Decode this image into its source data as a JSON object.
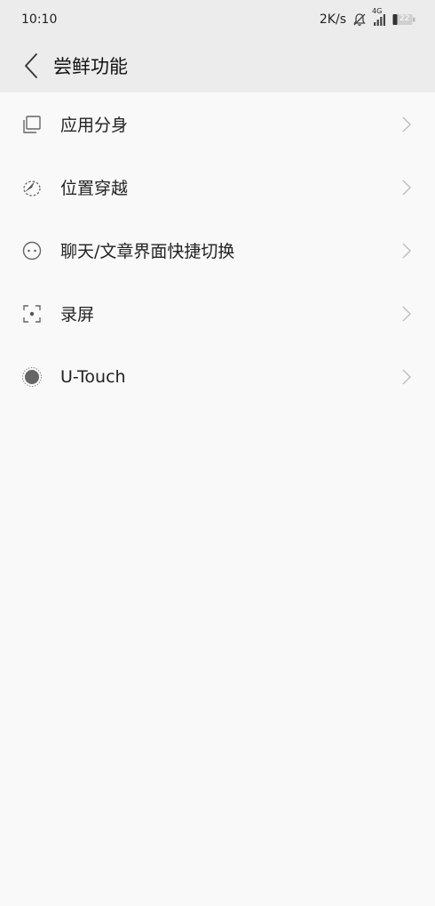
{
  "status_bar": {
    "time": "10:10",
    "network_speed": "2K/s",
    "network_type": "4G",
    "battery": "22",
    "icons": [
      "mute-bell-icon",
      "signal-icon",
      "battery-icon"
    ]
  },
  "header": {
    "back_icon": "back-chevron-icon",
    "title": "尝鲜功能"
  },
  "items": [
    {
      "label": "应用分身",
      "icon": "app-clone-icon"
    },
    {
      "label": "位置穿越",
      "icon": "location-travel-icon"
    },
    {
      "label": "聊天/文章界面快捷切换",
      "icon": "chat-switch-icon"
    },
    {
      "label": "录屏",
      "icon": "screen-record-icon"
    },
    {
      "label": "U-Touch",
      "icon": "u-touch-icon"
    }
  ],
  "colors": {
    "background": "#f9f9f9",
    "header_background": "#ececec",
    "icon_gray": "#666666",
    "chevron_gray": "#bdbdbd"
  }
}
